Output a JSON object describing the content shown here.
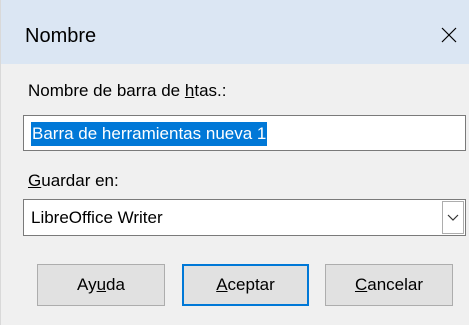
{
  "dialog": {
    "title": "Nombre",
    "close_symbol": "×"
  },
  "name_field": {
    "label_before": "Nombre de barra de ",
    "label_accel": "h",
    "label_after": "tas.:",
    "value": "Barra de herramientas nueva 1"
  },
  "save_field": {
    "label_accel": "G",
    "label_after": "uardar en:",
    "selected": "LibreOffice Writer"
  },
  "buttons": {
    "help_before": "Ay",
    "help_accel": "u",
    "help_after": "da",
    "ok_accel": "A",
    "ok_after": "ceptar",
    "cancel_accel": "C",
    "cancel_after": "ancelar"
  },
  "colors": {
    "titlebar": "#dbe6f3",
    "selection": "#0078d7",
    "dialog_bg": "#f0f0f0",
    "button_bg": "#e1e1e1"
  },
  "icons": {
    "close": "close-icon",
    "dropdown": "chevron-down-icon"
  }
}
